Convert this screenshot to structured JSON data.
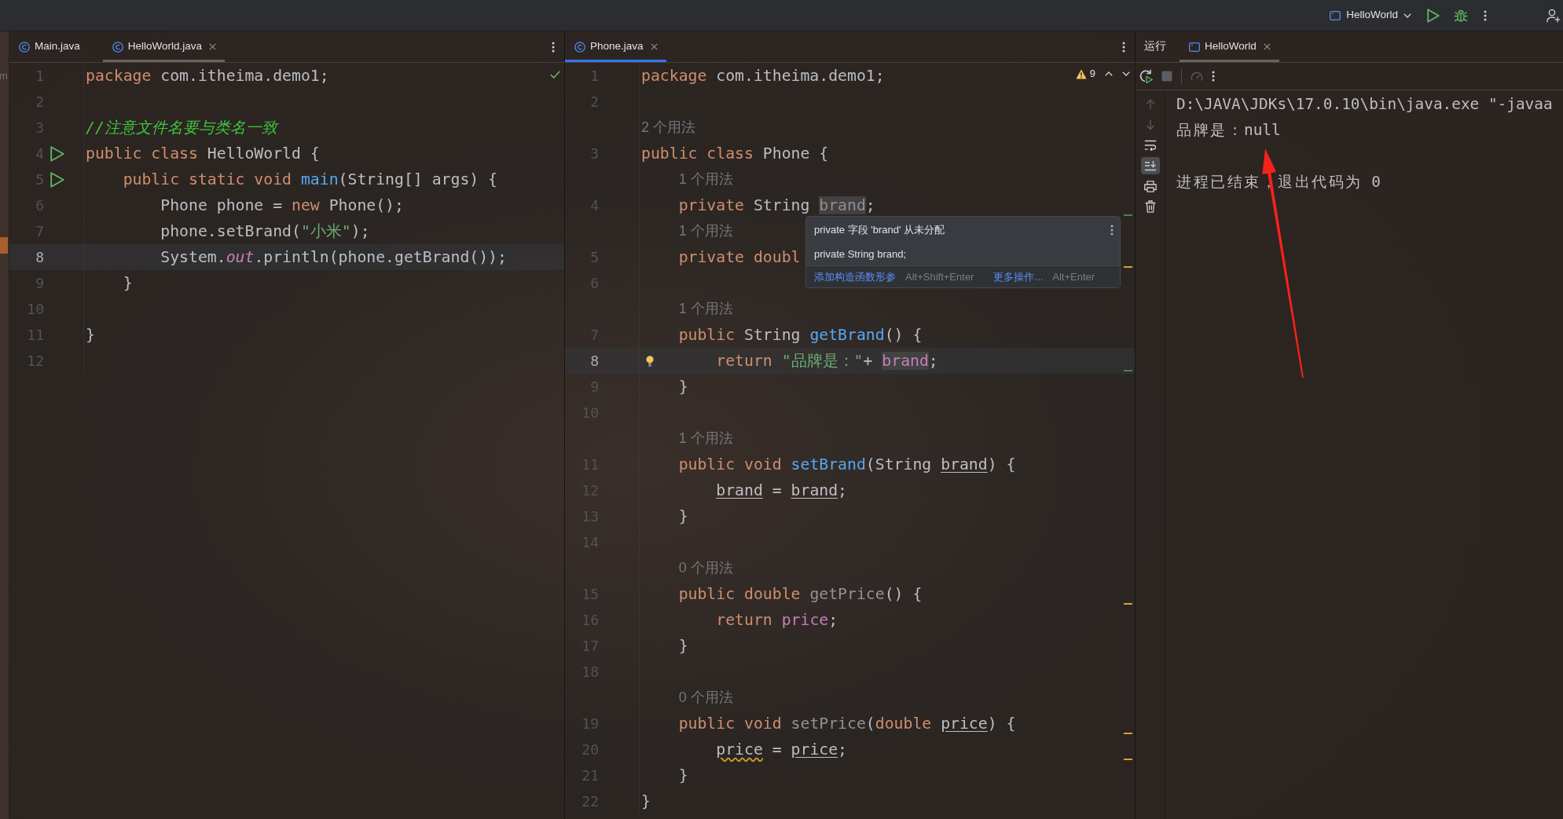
{
  "top_bar": {
    "run_config": {
      "label": "HelloWorld"
    }
  },
  "edge_strip": {
    "label": "m"
  },
  "editors": [
    {
      "focused": false,
      "tabs": [
        {
          "label": "Main.java",
          "selected": false,
          "closable": false
        },
        {
          "label": "HelloWorld.java",
          "selected": true,
          "closable": true
        }
      ],
      "status": {
        "kind": "ok"
      },
      "rows": [
        {
          "kind": "code",
          "number": "1",
          "highlighted": false,
          "tokens": [
            {
              "kind": "keyword",
              "text": "package "
            },
            {
              "kind": "plain",
              "text": "com.itheima.demo1;"
            }
          ]
        },
        {
          "kind": "code",
          "number": "2",
          "highlighted": false
        },
        {
          "kind": "code",
          "number": "3",
          "highlighted": false,
          "tokens": [
            {
              "kind": "comment",
              "text": "//注意文件名要与类名一致"
            }
          ]
        },
        {
          "kind": "code",
          "number": "4",
          "highlighted": false,
          "gutter_icon": {
            "kind": "run"
          },
          "tokens": [
            {
              "kind": "keyword",
              "text": "public class "
            },
            {
              "kind": "plain",
              "text": "HelloWorld {"
            }
          ]
        },
        {
          "kind": "code",
          "number": "5",
          "highlighted": false,
          "gutter_icon": {
            "kind": "run"
          },
          "tokens": [
            {
              "kind": "keyword",
              "text": "    public static void "
            },
            {
              "kind": "decl",
              "text": "main"
            },
            {
              "kind": "plain",
              "text": "(String[] args) {"
            }
          ]
        },
        {
          "kind": "code",
          "number": "6",
          "highlighted": false,
          "tokens": [
            {
              "kind": "plain",
              "text": "        Phone phone = "
            },
            {
              "kind": "keyword",
              "text": "new "
            },
            {
              "kind": "plain",
              "text": "Phone();"
            }
          ]
        },
        {
          "kind": "code",
          "number": "7",
          "highlighted": false,
          "tokens": [
            {
              "kind": "plain",
              "text": "        phone.setBrand("
            },
            {
              "kind": "string",
              "text": "\"小米\""
            },
            {
              "kind": "plain",
              "text": ");"
            }
          ]
        },
        {
          "kind": "code",
          "number": "8",
          "highlighted": true,
          "tokens": [
            {
              "kind": "plain",
              "text": "        System."
            },
            {
              "kind": "static",
              "text": "out"
            },
            {
              "kind": "plain",
              "text": ".println(phone.getBrand());"
            }
          ]
        },
        {
          "kind": "code",
          "number": "9",
          "highlighted": false,
          "tokens": [
            {
              "kind": "plain",
              "text": "    }"
            }
          ]
        },
        {
          "kind": "code",
          "number": "10",
          "highlighted": false
        },
        {
          "kind": "code",
          "number": "11",
          "highlighted": false,
          "tokens": [
            {
              "kind": "plain",
              "text": "}"
            }
          ]
        },
        {
          "kind": "code",
          "number": "12",
          "highlighted": false
        }
      ]
    },
    {
      "focused": true,
      "tabs": [
        {
          "label": "Phone.java",
          "selected": true,
          "closable": true
        }
      ],
      "status": {
        "kind": "warnings",
        "count": "9"
      },
      "rows": [
        {
          "kind": "code",
          "number": "1",
          "highlighted": false,
          "tokens": [
            {
              "kind": "keyword",
              "text": "package "
            },
            {
              "kind": "plain",
              "text": "com.itheima.demo1;"
            }
          ]
        },
        {
          "kind": "code",
          "number": "2",
          "highlighted": false
        },
        {
          "kind": "hint",
          "text": "2 个用法",
          "highlighted": false
        },
        {
          "kind": "code",
          "number": "3",
          "highlighted": false,
          "tokens": [
            {
              "kind": "keyword",
              "text": "public class "
            },
            {
              "kind": "plain",
              "text": "Phone {"
            }
          ]
        },
        {
          "kind": "hint",
          "text": "1 个用法",
          "highlighted": false
        },
        {
          "kind": "code",
          "number": "4",
          "highlighted": false,
          "marker": {
            "color": "#4e7d5b"
          },
          "tokens": [
            {
              "kind": "keyword",
              "text": "    private "
            },
            {
              "kind": "plain",
              "text": "String "
            },
            {
              "kind": "unused_field",
              "text": "brand"
            },
            {
              "kind": "plain",
              "text": ";"
            }
          ]
        },
        {
          "kind": "hint",
          "text": "1 个用法",
          "highlighted": false
        },
        {
          "kind": "code",
          "number": "5",
          "highlighted": false,
          "marker": {
            "color": "#d3a23a"
          },
          "tokens": [
            {
              "kind": "keyword",
              "text": "    private doubl"
            }
          ]
        },
        {
          "kind": "code",
          "number": "6",
          "highlighted": false
        },
        {
          "kind": "hint",
          "text": "1 个用法",
          "highlighted": false
        },
        {
          "kind": "code",
          "number": "7",
          "highlighted": false,
          "tokens": [
            {
              "kind": "keyword",
              "text": "    public "
            },
            {
              "kind": "plain",
              "text": "String "
            },
            {
              "kind": "decl",
              "text": "getBrand"
            },
            {
              "kind": "plain",
              "text": "() {"
            }
          ]
        },
        {
          "kind": "code",
          "number": "8",
          "highlighted": true,
          "gutter_icon": {
            "kind": "bulb"
          },
          "marker": {
            "color": "#4e7d5b"
          },
          "tokens": [
            {
              "kind": "keyword",
              "text": "        return "
            },
            {
              "kind": "string",
              "text": "\"品牌是：\""
            },
            {
              "kind": "plain",
              "text": "+ "
            },
            {
              "kind": "field_ref",
              "text": "brand"
            },
            {
              "kind": "plain",
              "text": ";"
            }
          ]
        },
        {
          "kind": "code",
          "number": "9",
          "highlighted": false,
          "tokens": [
            {
              "kind": "plain",
              "text": "    }"
            }
          ]
        },
        {
          "kind": "code",
          "number": "10",
          "highlighted": false
        },
        {
          "kind": "hint",
          "text": "1 个用法",
          "highlighted": false
        },
        {
          "kind": "code",
          "number": "11",
          "highlighted": false,
          "tokens": [
            {
              "kind": "keyword",
              "text": "    public void "
            },
            {
              "kind": "decl",
              "text": "setBrand"
            },
            {
              "kind": "plain",
              "text": "(String "
            },
            {
              "kind": "param",
              "text": "brand"
            },
            {
              "kind": "plain",
              "text": ") {"
            }
          ]
        },
        {
          "kind": "code",
          "number": "12",
          "highlighted": false,
          "tokens": [
            {
              "kind": "param",
              "text": "        brand"
            },
            {
              "kind": "plain",
              "text": " = "
            },
            {
              "kind": "param",
              "text": "brand"
            },
            {
              "kind": "plain",
              "text": ";"
            }
          ]
        },
        {
          "kind": "code",
          "number": "13",
          "highlighted": false,
          "tokens": [
            {
              "kind": "plain",
              "text": "    }"
            }
          ]
        },
        {
          "kind": "code",
          "number": "14",
          "highlighted": false
        },
        {
          "kind": "hint",
          "text": "0 个用法",
          "highlighted": false
        },
        {
          "kind": "code",
          "number": "15",
          "highlighted": false,
          "marker": {
            "color": "#d3a23a"
          },
          "tokens": [
            {
              "kind": "keyword",
              "text": "    public double "
            },
            {
              "kind": "unused",
              "text": "getPrice"
            },
            {
              "kind": "plain",
              "text": "() {"
            }
          ]
        },
        {
          "kind": "code",
          "number": "16",
          "highlighted": false,
          "tokens": [
            {
              "kind": "keyword",
              "text": "        return "
            },
            {
              "kind": "field",
              "text": "price"
            },
            {
              "kind": "plain",
              "text": ";"
            }
          ]
        },
        {
          "kind": "code",
          "number": "17",
          "highlighted": false,
          "tokens": [
            {
              "kind": "plain",
              "text": "    }"
            }
          ]
        },
        {
          "kind": "code",
          "number": "18",
          "highlighted": false
        },
        {
          "kind": "hint",
          "text": "0 个用法",
          "highlighted": false
        },
        {
          "kind": "code",
          "number": "19",
          "highlighted": false,
          "marker": {
            "color": "#d3a23a"
          },
          "tokens": [
            {
              "kind": "keyword",
              "text": "    public void "
            },
            {
              "kind": "unused",
              "text": "setPrice"
            },
            {
              "kind": "plain",
              "text": "("
            },
            {
              "kind": "keyword",
              "text": "double "
            },
            {
              "kind": "param",
              "text": "price"
            },
            {
              "kind": "plain",
              "text": ") {"
            }
          ]
        },
        {
          "kind": "code",
          "number": "20",
          "highlighted": false,
          "marker": {
            "color": "#d3a23a"
          },
          "tokens": [
            {
              "kind": "wavy",
              "text": "        price"
            },
            {
              "kind": "plain",
              "text": " = "
            },
            {
              "kind": "param",
              "text": "price"
            },
            {
              "kind": "plain",
              "text": ";"
            }
          ]
        },
        {
          "kind": "code",
          "number": "21",
          "highlighted": false,
          "tokens": [
            {
              "kind": "plain",
              "text": "    }"
            }
          ]
        },
        {
          "kind": "code",
          "number": "22",
          "highlighted": false,
          "tokens": [
            {
              "kind": "plain",
              "text": "}"
            }
          ]
        }
      ],
      "popup": {
        "title": "private 字段 'brand' 从未分配",
        "code": "private String brand;",
        "actions": [
          {
            "label": "添加构造函数形参",
            "shortcut": "Alt+Shift+Enter"
          },
          {
            "label": "更多操作...",
            "shortcut": "Alt+Enter"
          }
        ]
      }
    }
  ],
  "run_panel": {
    "title": "运行",
    "tabs": [
      {
        "label": "HelloWorld",
        "selected": true,
        "closable": true
      }
    ],
    "toolbar": [
      {
        "disabled": false
      },
      {
        "disabled": true
      },
      {
        "disabled": true
      },
      {
        "disabled": false
      }
    ],
    "side_tools": [
      {
        "disabled": true,
        "on": false
      },
      {
        "disabled": true,
        "on": false
      },
      {
        "disabled": false,
        "on": false
      },
      {
        "disabled": false,
        "on": true
      },
      {
        "disabled": false,
        "on": false
      },
      {
        "disabled": false,
        "on": false
      }
    ],
    "output": [
      {
        "kind": "command",
        "text": "D:\\JAVA\\JDKs\\17.0.10\\bin\\java.exe \"-javaa"
      },
      {
        "kind": "output",
        "text": "品牌是：null"
      },
      {
        "kind": "exit",
        "text": "进程已结束，退出代码为 0"
      }
    ]
  }
}
